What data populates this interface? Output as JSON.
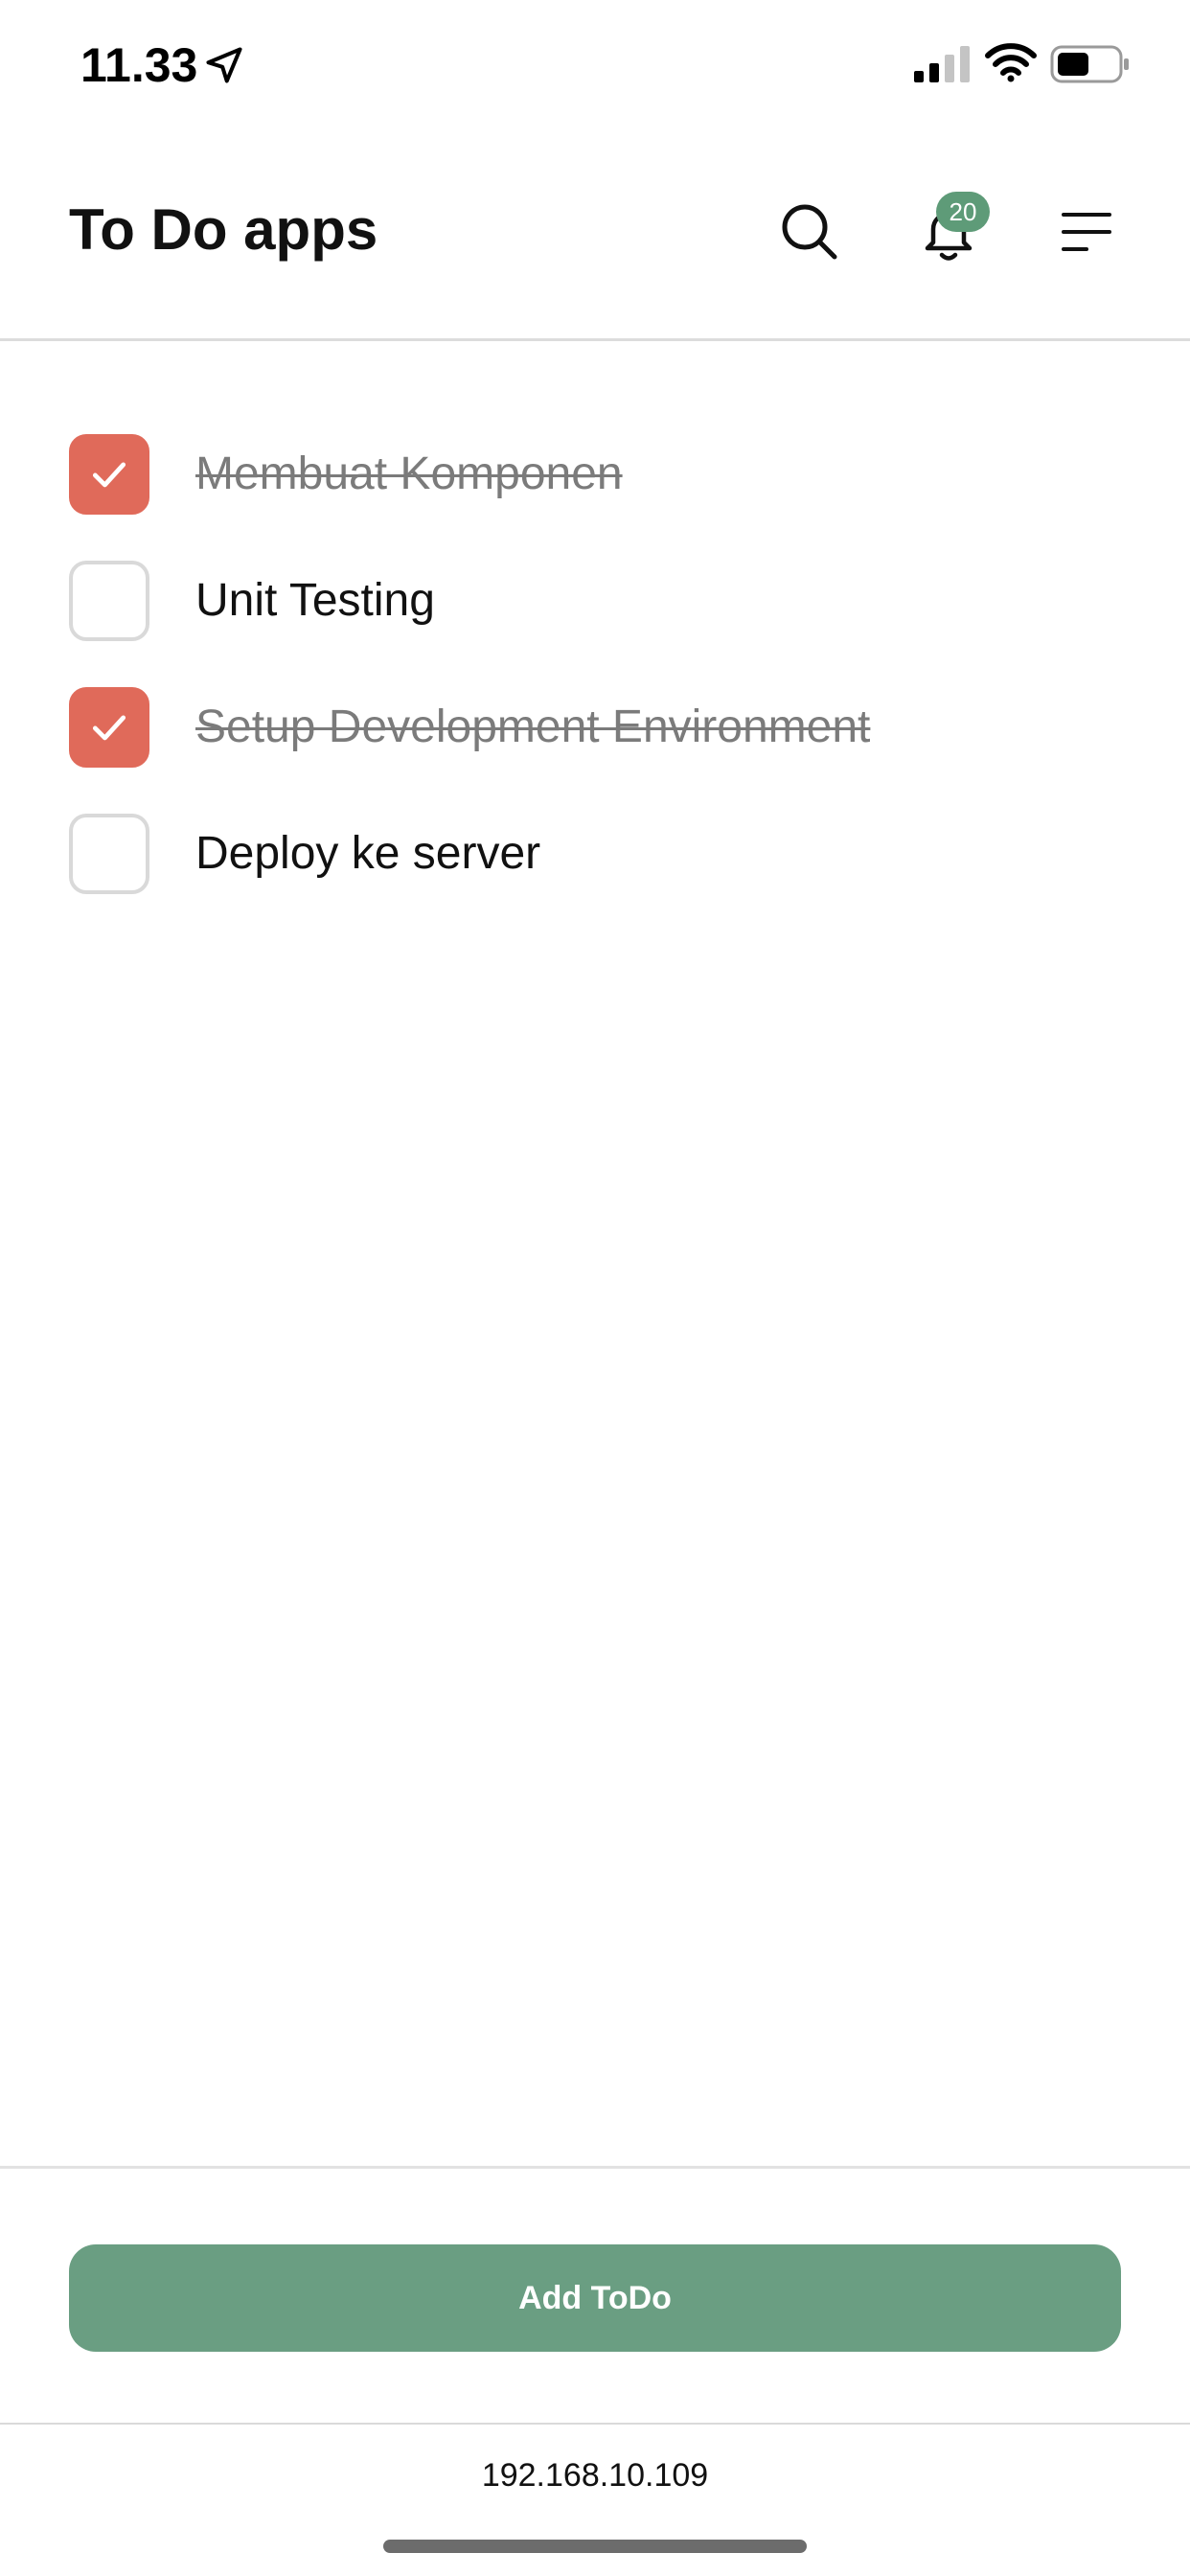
{
  "status_bar": {
    "time": "11.33",
    "icons": [
      "location-arrow-icon",
      "cellular-signal-icon",
      "wifi-icon",
      "battery-icon"
    ]
  },
  "header": {
    "title": "To Do apps",
    "notification_count": "20",
    "icons": [
      "search-icon",
      "bell-icon",
      "menu-icon"
    ]
  },
  "todos": [
    {
      "label": "Membuat Komponen",
      "done": true
    },
    {
      "label": "Unit Testing",
      "done": false
    },
    {
      "label": "Setup Development Environment",
      "done": true
    },
    {
      "label": "Deploy ke server",
      "done": false
    }
  ],
  "footer": {
    "add_button_label": "Add ToDo",
    "url": "192.168.10.109"
  },
  "colors": {
    "checked": "#e06a5a",
    "accent_green": "#6a9e82",
    "badge_green": "#5e9b78"
  }
}
